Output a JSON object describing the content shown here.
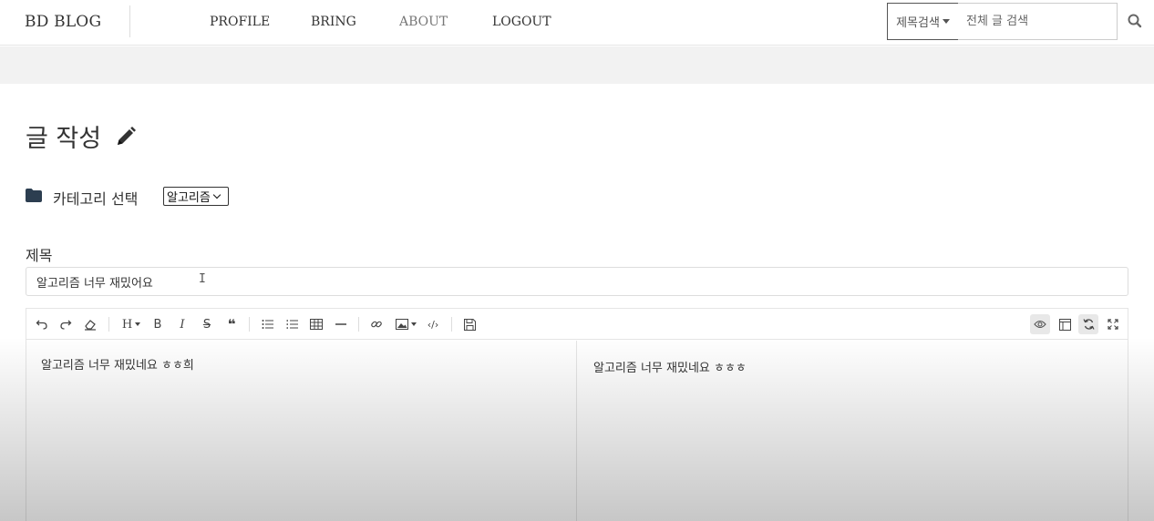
{
  "navbar": {
    "brand": "BD BLOG",
    "links": [
      "PROFILE",
      "BRING",
      "ABOUT",
      "LOGOUT"
    ],
    "search_type": "제목검색",
    "search_placeholder": "전체 글 검색",
    "search_icon": "search-icon"
  },
  "page": {
    "title": "글 작성",
    "title_icon": "pencil-icon"
  },
  "category": {
    "icon": "folder-icon",
    "label": "카테고리 선택",
    "selected": "알고리즘"
  },
  "subject": {
    "label": "제목",
    "value": "알고리즘 너무 재밌어요"
  },
  "editor": {
    "toolbar_left": [
      "undo-icon",
      "redo-icon",
      "eraser-icon",
      "heading-icon",
      "bold-icon",
      "italic-icon",
      "strikethrough-icon",
      "quote-icon",
      "unordered-list-icon",
      "ordered-list-icon",
      "table-icon",
      "horizontal-rule-icon",
      "link-icon",
      "image-icon",
      "code-icon",
      "save-icon"
    ],
    "toolbar_right": [
      "preview-icon",
      "side-by-side-icon",
      "sync-scroll-icon",
      "fullscreen-icon"
    ],
    "heading_label": "H",
    "bold_label": "B",
    "italic_label": "I",
    "strike_label": "S",
    "quote_label": "❝",
    "source_text": "알고리즘 너무 재밌네요 ㅎㅎ희",
    "preview_text": "알고리즘 너무 재밌네요 ㅎㅎㅎ"
  }
}
